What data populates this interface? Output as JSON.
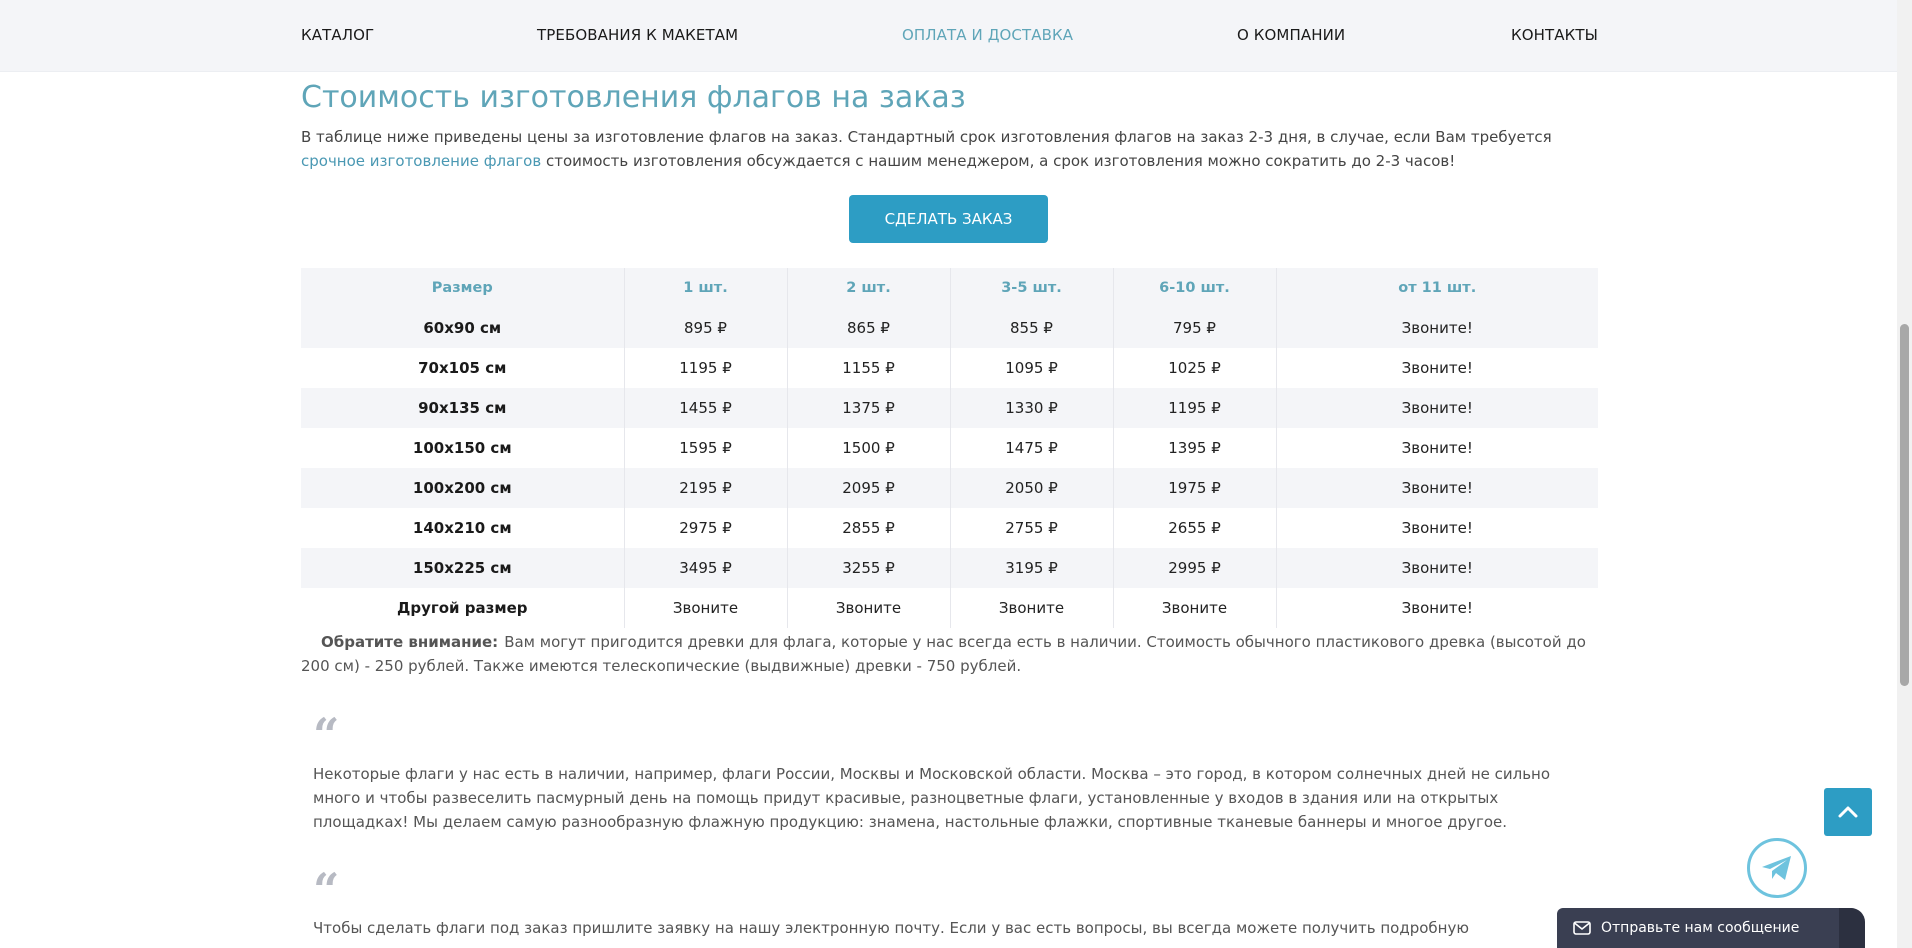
{
  "nav": {
    "items": [
      {
        "label": "КАТАЛОГ"
      },
      {
        "label": "ТРЕБОВАНИЯ К МАКЕТАМ"
      },
      {
        "label": "ОПЛАТА И ДОСТАВКА"
      },
      {
        "label": "О КОМПАНИИ"
      },
      {
        "label": "КОНТАКТЫ"
      }
    ],
    "active_index": 2
  },
  "title": "Стоимость изготовления флагов на заказ",
  "intro": {
    "text_before": "В таблице ниже приведены цены за изготовление флагов на заказ. Стандартный срок изготовления флагов на заказ 2-3 дня, в случае, если Вам требуется ",
    "link": "срочное изготовление флагов",
    "text_after": " стоимость изготовления обсуждается с нашим менеджером, а срок изготовления можно сократить до 2-3 часов!"
  },
  "order_button": "СДЕЛАТЬ ЗАКАЗ",
  "table": {
    "headers": [
      "Размер",
      "1 шт.",
      "2 шт.",
      "3-5 шт.",
      "6-10 шт.",
      "от 11 шт."
    ],
    "rows": [
      [
        "60х90 см",
        "895 ₽",
        "865 ₽",
        "855 ₽",
        "795 ₽",
        "Звоните!"
      ],
      [
        "70х105 см",
        "1195 ₽",
        "1155 ₽",
        "1095 ₽",
        "1025 ₽",
        "Звоните!"
      ],
      [
        "90х135 см",
        "1455 ₽",
        "1375 ₽",
        "1330 ₽",
        "1195 ₽",
        "Звоните!"
      ],
      [
        "100х150 см",
        "1595 ₽",
        "1500 ₽",
        "1475 ₽",
        "1395 ₽",
        "Звоните!"
      ],
      [
        "100х200 см",
        "2195 ₽",
        "2095 ₽",
        "2050 ₽",
        "1975 ₽",
        "Звоните!"
      ],
      [
        "140х210 см",
        "2975 ₽",
        "2855 ₽",
        "2755 ₽",
        "2655 ₽",
        "Звоните!"
      ],
      [
        "150х225 см",
        "3495 ₽",
        "3255 ₽",
        "3195 ₽",
        "2995 ₽",
        "Звоните!"
      ],
      [
        "Другой размер",
        "Звоните",
        "Звоните",
        "Звоните",
        "Звоните",
        "Звоните!"
      ]
    ]
  },
  "note": {
    "label": "Обратите внимание:",
    "text": "Вам могут пригодится древки для флага, которые у нас всегда есть в наличии. Стоимость обычного пластикового древка (высотой до 200 см) - 250 рублей. Также имеются телескопические (выдвижные) древки - 750 рублей."
  },
  "quotes": [
    {
      "mark": "“",
      "text": "Некоторые флаги у нас есть в наличии, например, флаги России, Москвы и Московской области. Москва – это город, в котором солнечных дней не сильно много и чтобы развеселить пасмурный день на помощь придут красивые, разноцветные флаги, установленные у входов в здания или на открытых площадках! Мы делаем самую разнообразную флажную продукцию: знамена, настольные флажки, спортивные тканевые баннеры и многое другое."
    },
    {
      "mark": "“",
      "text": "Чтобы сделать флаги под заказ пришлите заявку на нашу электронную почту. Если у вас есть вопросы, вы всегда можете получить подробную консультацию у"
    }
  ],
  "chat": {
    "label": "Отправьте нам сообщение"
  },
  "icons": {
    "scroll_top": "chevron-up-icon",
    "telegram": "telegram-icon",
    "mail": "mail-icon"
  },
  "colors": {
    "accent": "#5fa5b8",
    "button": "#2d9dc4",
    "chat_bar": "#3a3f52"
  }
}
